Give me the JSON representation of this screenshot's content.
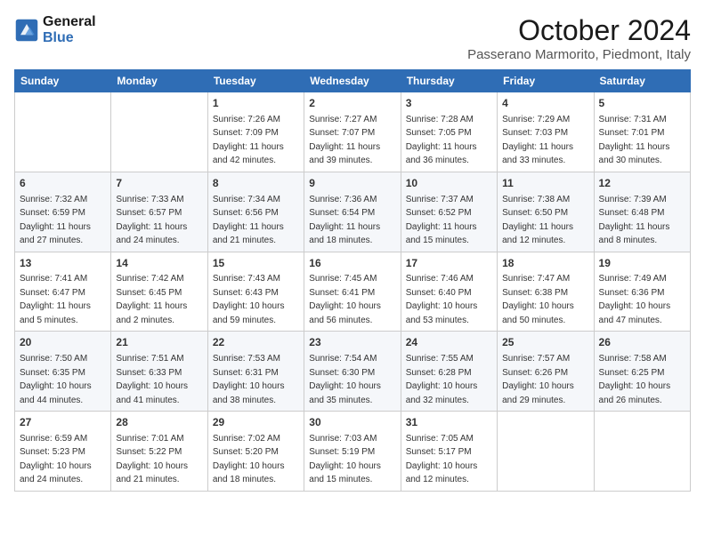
{
  "header": {
    "logo_line1": "General",
    "logo_line2": "Blue",
    "month_title": "October 2024",
    "location": "Passerano Marmorito, Piedmont, Italy"
  },
  "weekdays": [
    "Sunday",
    "Monday",
    "Tuesday",
    "Wednesday",
    "Thursday",
    "Friday",
    "Saturday"
  ],
  "weeks": [
    [
      {
        "day": "",
        "sunrise": "",
        "sunset": "",
        "daylight": ""
      },
      {
        "day": "",
        "sunrise": "",
        "sunset": "",
        "daylight": ""
      },
      {
        "day": "1",
        "sunrise": "Sunrise: 7:26 AM",
        "sunset": "Sunset: 7:09 PM",
        "daylight": "Daylight: 11 hours and 42 minutes."
      },
      {
        "day": "2",
        "sunrise": "Sunrise: 7:27 AM",
        "sunset": "Sunset: 7:07 PM",
        "daylight": "Daylight: 11 hours and 39 minutes."
      },
      {
        "day": "3",
        "sunrise": "Sunrise: 7:28 AM",
        "sunset": "Sunset: 7:05 PM",
        "daylight": "Daylight: 11 hours and 36 minutes."
      },
      {
        "day": "4",
        "sunrise": "Sunrise: 7:29 AM",
        "sunset": "Sunset: 7:03 PM",
        "daylight": "Daylight: 11 hours and 33 minutes."
      },
      {
        "day": "5",
        "sunrise": "Sunrise: 7:31 AM",
        "sunset": "Sunset: 7:01 PM",
        "daylight": "Daylight: 11 hours and 30 minutes."
      }
    ],
    [
      {
        "day": "6",
        "sunrise": "Sunrise: 7:32 AM",
        "sunset": "Sunset: 6:59 PM",
        "daylight": "Daylight: 11 hours and 27 minutes."
      },
      {
        "day": "7",
        "sunrise": "Sunrise: 7:33 AM",
        "sunset": "Sunset: 6:57 PM",
        "daylight": "Daylight: 11 hours and 24 minutes."
      },
      {
        "day": "8",
        "sunrise": "Sunrise: 7:34 AM",
        "sunset": "Sunset: 6:56 PM",
        "daylight": "Daylight: 11 hours and 21 minutes."
      },
      {
        "day": "9",
        "sunrise": "Sunrise: 7:36 AM",
        "sunset": "Sunset: 6:54 PM",
        "daylight": "Daylight: 11 hours and 18 minutes."
      },
      {
        "day": "10",
        "sunrise": "Sunrise: 7:37 AM",
        "sunset": "Sunset: 6:52 PM",
        "daylight": "Daylight: 11 hours and 15 minutes."
      },
      {
        "day": "11",
        "sunrise": "Sunrise: 7:38 AM",
        "sunset": "Sunset: 6:50 PM",
        "daylight": "Daylight: 11 hours and 12 minutes."
      },
      {
        "day": "12",
        "sunrise": "Sunrise: 7:39 AM",
        "sunset": "Sunset: 6:48 PM",
        "daylight": "Daylight: 11 hours and 8 minutes."
      }
    ],
    [
      {
        "day": "13",
        "sunrise": "Sunrise: 7:41 AM",
        "sunset": "Sunset: 6:47 PM",
        "daylight": "Daylight: 11 hours and 5 minutes."
      },
      {
        "day": "14",
        "sunrise": "Sunrise: 7:42 AM",
        "sunset": "Sunset: 6:45 PM",
        "daylight": "Daylight: 11 hours and 2 minutes."
      },
      {
        "day": "15",
        "sunrise": "Sunrise: 7:43 AM",
        "sunset": "Sunset: 6:43 PM",
        "daylight": "Daylight: 10 hours and 59 minutes."
      },
      {
        "day": "16",
        "sunrise": "Sunrise: 7:45 AM",
        "sunset": "Sunset: 6:41 PM",
        "daylight": "Daylight: 10 hours and 56 minutes."
      },
      {
        "day": "17",
        "sunrise": "Sunrise: 7:46 AM",
        "sunset": "Sunset: 6:40 PM",
        "daylight": "Daylight: 10 hours and 53 minutes."
      },
      {
        "day": "18",
        "sunrise": "Sunrise: 7:47 AM",
        "sunset": "Sunset: 6:38 PM",
        "daylight": "Daylight: 10 hours and 50 minutes."
      },
      {
        "day": "19",
        "sunrise": "Sunrise: 7:49 AM",
        "sunset": "Sunset: 6:36 PM",
        "daylight": "Daylight: 10 hours and 47 minutes."
      }
    ],
    [
      {
        "day": "20",
        "sunrise": "Sunrise: 7:50 AM",
        "sunset": "Sunset: 6:35 PM",
        "daylight": "Daylight: 10 hours and 44 minutes."
      },
      {
        "day": "21",
        "sunrise": "Sunrise: 7:51 AM",
        "sunset": "Sunset: 6:33 PM",
        "daylight": "Daylight: 10 hours and 41 minutes."
      },
      {
        "day": "22",
        "sunrise": "Sunrise: 7:53 AM",
        "sunset": "Sunset: 6:31 PM",
        "daylight": "Daylight: 10 hours and 38 minutes."
      },
      {
        "day": "23",
        "sunrise": "Sunrise: 7:54 AM",
        "sunset": "Sunset: 6:30 PM",
        "daylight": "Daylight: 10 hours and 35 minutes."
      },
      {
        "day": "24",
        "sunrise": "Sunrise: 7:55 AM",
        "sunset": "Sunset: 6:28 PM",
        "daylight": "Daylight: 10 hours and 32 minutes."
      },
      {
        "day": "25",
        "sunrise": "Sunrise: 7:57 AM",
        "sunset": "Sunset: 6:26 PM",
        "daylight": "Daylight: 10 hours and 29 minutes."
      },
      {
        "day": "26",
        "sunrise": "Sunrise: 7:58 AM",
        "sunset": "Sunset: 6:25 PM",
        "daylight": "Daylight: 10 hours and 26 minutes."
      }
    ],
    [
      {
        "day": "27",
        "sunrise": "Sunrise: 6:59 AM",
        "sunset": "Sunset: 5:23 PM",
        "daylight": "Daylight: 10 hours and 24 minutes."
      },
      {
        "day": "28",
        "sunrise": "Sunrise: 7:01 AM",
        "sunset": "Sunset: 5:22 PM",
        "daylight": "Daylight: 10 hours and 21 minutes."
      },
      {
        "day": "29",
        "sunrise": "Sunrise: 7:02 AM",
        "sunset": "Sunset: 5:20 PM",
        "daylight": "Daylight: 10 hours and 18 minutes."
      },
      {
        "day": "30",
        "sunrise": "Sunrise: 7:03 AM",
        "sunset": "Sunset: 5:19 PM",
        "daylight": "Daylight: 10 hours and 15 minutes."
      },
      {
        "day": "31",
        "sunrise": "Sunrise: 7:05 AM",
        "sunset": "Sunset: 5:17 PM",
        "daylight": "Daylight: 10 hours and 12 minutes."
      },
      {
        "day": "",
        "sunrise": "",
        "sunset": "",
        "daylight": ""
      },
      {
        "day": "",
        "sunrise": "",
        "sunset": "",
        "daylight": ""
      }
    ]
  ]
}
